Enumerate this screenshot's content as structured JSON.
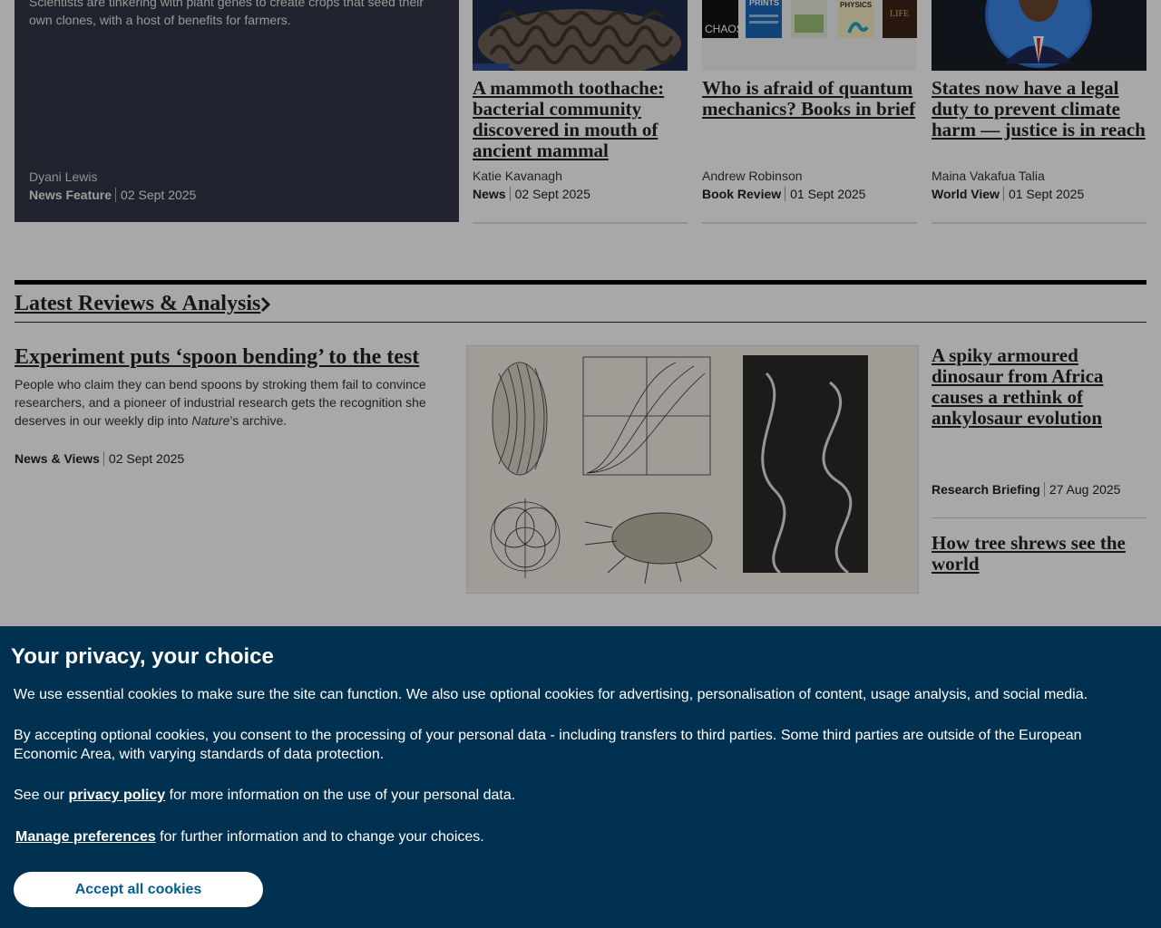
{
  "feature": {
    "summary": "Scientists are tinkering with plant genes to create crops that seed their own clones, with a host of benefits for farmers.",
    "author": "Dyani Lewis",
    "type": "News Feature",
    "date": "02 Sept 2025"
  },
  "cards": [
    {
      "title": "A mammoth toothache: bacterial community discovered in mouth of ancient mammal",
      "author": "Katie Kavanagh",
      "type": "News",
      "date": "02 Sept 2025",
      "image": "mammoth-tooth-image"
    },
    {
      "title": "Who is afraid of quantum mechanics? Books in brief",
      "author": "Andrew Robinson",
      "type": "Book Review",
      "date": "01 Sept 2025",
      "image": "book-covers-image",
      "book_labels": [
        "CHAOS",
        "PRINTS",
        "PHYSICS",
        "LIFE"
      ]
    },
    {
      "title": "States now have a legal duty to prevent climate harm — justice is in reach",
      "author": "Maina Vakafua Talia",
      "type": "World View",
      "date": "01 Sept 2025",
      "image": "author-portrait-image"
    }
  ],
  "reviews": {
    "section_title": "Latest Reviews & Analysis",
    "lead": {
      "title": "Experiment puts ‘spoon bending’ to the test",
      "summary_before": "People who claim they can bend spoons by stroking them fail to convince researchers, and a pioneer of industrial research gets the recognition she deserves in our weekly dip into ",
      "summary_italic": "Nature",
      "summary_after": "’s archive.",
      "type": "News & Views",
      "date": "02 Sept 2025"
    },
    "side": [
      {
        "title": "A spiky armoured dinosaur from Africa causes a rethink of ankylosaur evolution",
        "type": "Research Briefing",
        "date": "27 Aug 2025"
      },
      {
        "title": "How tree shrews see the world"
      }
    ]
  },
  "privacy": {
    "heading": "Your privacy, your choice",
    "p1": "We use essential cookies to make sure the site can function. We also use optional cookies for advertising, personalisation of content, usage analysis, and social media.",
    "p2": "By accepting optional cookies, you consent to the processing of your personal data - including transfers to third parties. Some third parties are outside of the European Economic Area, with varying standards of data protection.",
    "p3_before": "See our ",
    "p3_link": "privacy policy",
    "p3_after": " for more information on the use of your personal data.",
    "p4_link": "Manage preferences",
    "p4_after": " for further information and to change your choices.",
    "accept_label": "Accept all cookies"
  },
  "colors": {
    "banner_bg": "#003150",
    "feature_bg": "#313645",
    "accept_text": "#025e8d"
  }
}
